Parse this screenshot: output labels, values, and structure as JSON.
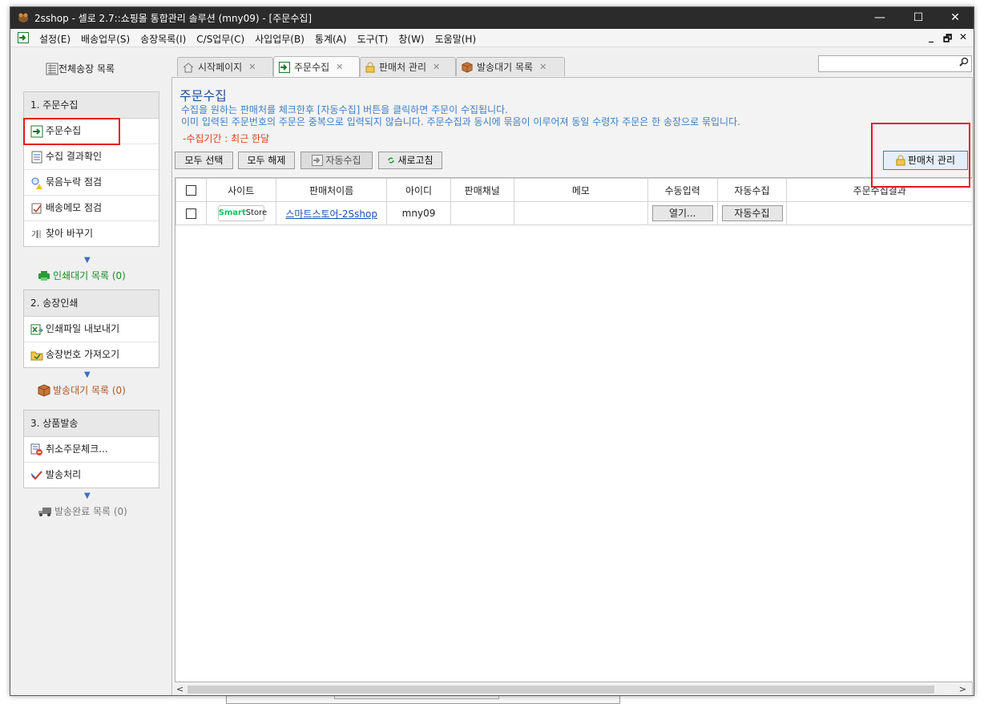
{
  "window": {
    "title": "2sshop - 셀로 2.7::쇼핑몰 통합관리 솔루션 (mny09) - [주문수집]",
    "controls": {
      "minimize": "—",
      "maximize": "☐",
      "close": "✕"
    }
  },
  "menu": {
    "items": [
      "설정(E)",
      "배송업무(S)",
      "송장목록(I)",
      "C/S업무(C)",
      "사입업무(B)",
      "통계(A)",
      "도구(T)",
      "창(W)",
      "도움말(H)"
    ],
    "mdi_controls": {
      "minimize": "_",
      "restore": "🗗",
      "close": "✕"
    }
  },
  "sidebar": {
    "top_link": "전체송장 목록",
    "sections": [
      {
        "header": "1. 주문수집",
        "items": [
          "주문수집",
          "수집 결과확인",
          "묶음누락 점검",
          "배송메모 점검",
          "찾아 바꾸기"
        ],
        "queue": "인쇄대기 목록 (0)"
      },
      {
        "header": "2. 송장인쇄",
        "items": [
          "인쇄파일 내보내기",
          "송장번호 가져오기"
        ],
        "queue": "발송대기 목록 (0)"
      },
      {
        "header": "3. 상품발송",
        "items": [
          "취소주문체크...",
          "발송처리"
        ],
        "queue": "발송완료 목록 (0)"
      }
    ]
  },
  "tabs": [
    {
      "label": "시작페이지",
      "icon": "home-icon",
      "active": false
    },
    {
      "label": "주문수집",
      "icon": "import-icon",
      "active": true
    },
    {
      "label": "판매처 관리",
      "icon": "lock-icon",
      "active": false
    },
    {
      "label": "발송대기 목록",
      "icon": "box-icon",
      "active": false
    }
  ],
  "search": {
    "value": "",
    "icon": "search-icon"
  },
  "content": {
    "title": "주문수집",
    "desc_line1": "수집을 원하는 판매처를 체크한후 [자동수집] 버튼을 클릭하면 주문이 수집됩니다.",
    "desc_line2": "이미 입력된 주문번호의 주문은 중복으로 입력되지 않습니다. 주문수집과 동시에 묶음이 이루어져 동일 수령자 주문은 한 송장으로 묶입니다.",
    "period": "-수집기간 : 최근 한달",
    "buttons": {
      "select_all": "모두 선택",
      "deselect_all": "모두 해제",
      "auto_collect": "자동수집",
      "refresh": "새로고침",
      "seller_manage": "판매처 관리"
    },
    "table": {
      "columns": [
        "",
        "사이트",
        "판매처이름",
        "아이디",
        "판매채널",
        "메모",
        "수동입력",
        "자동수집",
        "주문수집결과"
      ],
      "rows": [
        {
          "site_logo_a": "Smart",
          "site_logo_b": "Store",
          "seller": "스마트스토어-2Sshop",
          "id": "mny09",
          "channel": "",
          "memo": "",
          "manual": "열기...",
          "auto": "자동수집",
          "result": ""
        }
      ]
    }
  },
  "colors": {
    "accent_blue": "#1f4f9a",
    "desc_blue": "#3c7fc7",
    "period_red": "#e2401f",
    "highlight_red": "#e8141c",
    "queue_green": "#178a2a"
  }
}
